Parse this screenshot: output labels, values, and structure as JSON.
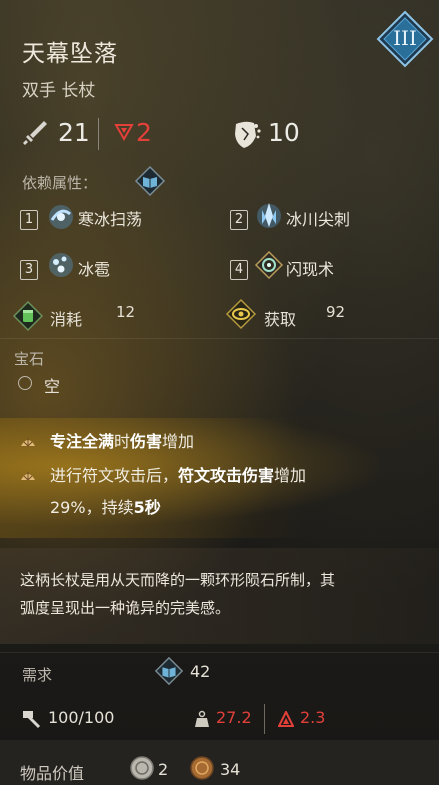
{
  "item": {
    "name": "天幕坠落",
    "type": "双手 长杖",
    "tier_badge": "III"
  },
  "stats": {
    "damage": "21",
    "red_value": "2",
    "defense": "10"
  },
  "dependency": {
    "label": "依赖属性："
  },
  "skills": [
    {
      "slot": "1",
      "name": "寒冰扫荡",
      "icon": "ice-sweep-icon"
    },
    {
      "slot": "2",
      "name": "冰川尖刺",
      "icon": "glacier-spike-icon"
    },
    {
      "slot": "3",
      "name": "冰雹",
      "icon": "hail-icon"
    },
    {
      "slot": "4",
      "name": "闪现术",
      "icon": "blink-icon"
    }
  ],
  "consume": {
    "label": "消耗",
    "value": "12"
  },
  "gain": {
    "label": "获取",
    "value": "92"
  },
  "gem": {
    "title": "宝石",
    "slot_text": "空"
  },
  "affixes": {
    "a1_part1": "专注全满",
    "a1_part2": "时",
    "a1_part3": "伤害",
    "a1_part4": "增加",
    "a2_line1_part1": "进行符文攻击后，",
    "a2_line1_part2": "符文攻击伤害",
    "a2_line1_part3": "增加",
    "a2_line2_part1": "29%，持续",
    "a2_line2_part2": "5秒"
  },
  "description": {
    "line1": "这柄长杖是用从天而降的一颗环形陨石所制，其",
    "line2": "弧度呈现出一种诡异的完美感。"
  },
  "requirement": {
    "label": "需求",
    "value": "42"
  },
  "durability": {
    "value": "100/100"
  },
  "weight": {
    "value": "27.2"
  },
  "red_stat": {
    "value": "2.3"
  },
  "item_value": {
    "label": "物品价值",
    "silver": "2",
    "bronze": "34"
  },
  "colors": {
    "accent_red": "#e3403a",
    "gold": "#c9a13a",
    "blue_badge": "#2a6f9a"
  }
}
